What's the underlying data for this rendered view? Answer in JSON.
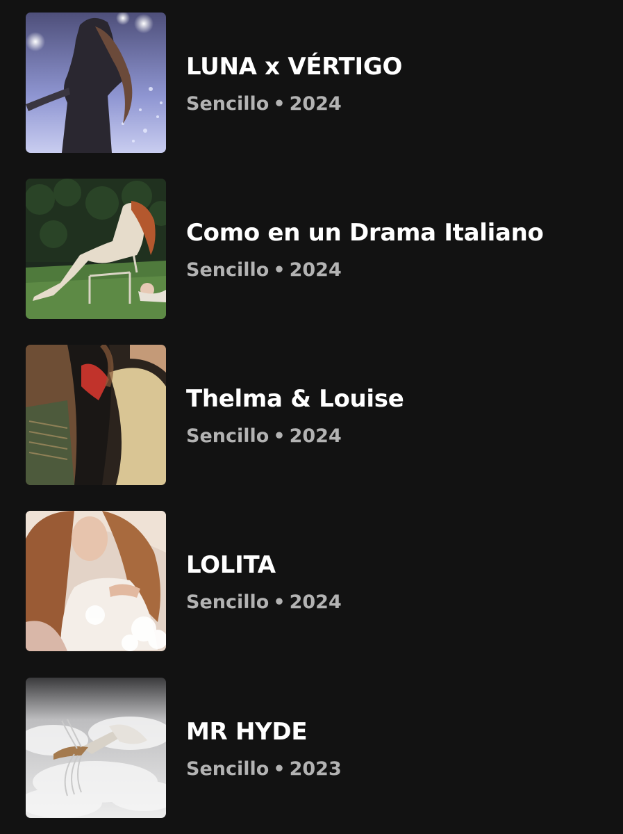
{
  "releases": [
    {
      "title": "LUNA x VÉRTIGO",
      "type": "Sencillo",
      "separator": "•",
      "year": "2024",
      "cover": "concert-stage-cover"
    },
    {
      "title": "Como en un Drama Italiano",
      "type": "Sencillo",
      "separator": "•",
      "year": "2024",
      "cover": "garden-chair-cover"
    },
    {
      "title": "Thelma & Louise",
      "type": "Sencillo",
      "separator": "•",
      "year": "2024",
      "cover": "blurred-hair-cover"
    },
    {
      "title": "LOLITA",
      "type": "Sencillo",
      "separator": "•",
      "year": "2024",
      "cover": "portrait-feathers-cover"
    },
    {
      "title": "MR HYDE",
      "type": "Sencillo",
      "separator": "•",
      "year": "2023",
      "cover": "angel-clouds-cover"
    }
  ],
  "colors": {
    "background": "#121212",
    "title": "#ffffff",
    "subtitle": "#b3b3b3"
  }
}
